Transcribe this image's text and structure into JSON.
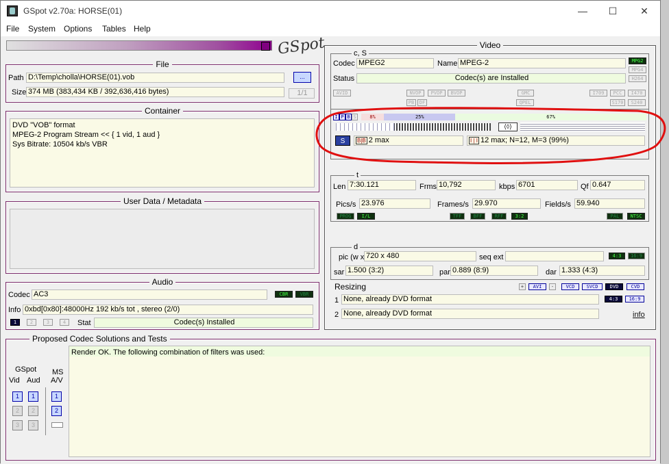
{
  "window": {
    "title": "GSpot v2.70a: HORSE(01)",
    "minimize": "—",
    "maximize": "☐",
    "close": "✕"
  },
  "menu": [
    "File",
    "System",
    "Options",
    "Tables",
    "Help"
  ],
  "logo": "GSpot",
  "file": {
    "title": "File",
    "path_label": "Path",
    "path_value": "D:\\Temp\\cholla\\HORSE(01).vob",
    "browse_label": "...",
    "size_label": "Size",
    "size_value": "374 MB (383,434 KB / 392,636,416 bytes)",
    "page_label": "1/1"
  },
  "container": {
    "title": "Container",
    "lines": [
      "DVD \"VOB\" format",
      "MPEG-2 Program Stream << { 1 vid, 1 aud }",
      "Sys Bitrate: 10504 kb/s VBR"
    ]
  },
  "userdata": {
    "title": "User Data / Metadata"
  },
  "audio": {
    "title": "Audio",
    "codec_label": "Codec",
    "codec_value": "AC3",
    "cbr": "CBR",
    "vbr": "VBR",
    "info_label": "Info",
    "info_value": "0xbd[0x80]:48000Hz  192 kb/s tot , stereo (2/0)",
    "tracks": [
      "1",
      "2",
      "3",
      "4"
    ],
    "stat_label": "Stat",
    "stat_value": "Codec(s) Installed"
  },
  "video": {
    "title": "Video",
    "cs_title": "c, S",
    "codec_label": "Codec",
    "codec_value": "MPEG2",
    "name_label": "Name",
    "name_value": "MPEG-2",
    "codec_chips": [
      "MPG2",
      "MPG4",
      "H264"
    ],
    "status_label": "Status",
    "status_value": "Codec(s) are Installed",
    "chips_row1": [
      "AVID",
      "NVOP",
      "PVOP",
      "BVOP",
      "GMC",
      "I709",
      "PCC",
      "I470"
    ],
    "chips_row2": [
      "PB",
      "DF",
      "QPEL",
      "S170",
      "S240"
    ],
    "gop": {
      "frame_types": [
        "I",
        "P",
        "B",
        "S"
      ],
      "pct_i": "8%",
      "pct_p": "25%",
      "pct_b": "67%",
      "pct_i_value": 8,
      "pct_p_value": 25,
      "pct_b_value": 67,
      "bframes_label": "2 max",
      "gop_label": "12 max; N=12, M=3 (99%)"
    },
    "t_title": "t",
    "len_label": "Len",
    "len_value": "7:30.121",
    "frms_label": "Frms",
    "frms_value": "10,792",
    "kbps_label": "kbps",
    "kbps_value": "6701",
    "qf_label": "Qf",
    "qf_value": "0.647",
    "pics_label": "Pics/s",
    "pics_value": "23.976",
    "frames_label": "Frames/s",
    "frames_value": "29.970",
    "fields_label": "Fields/s",
    "fields_value": "59.940",
    "t_chips": [
      "PROG",
      "I/L",
      "TFF",
      "BFF",
      "RFF",
      "3:2",
      "PAL",
      "NTSC"
    ],
    "d_title": "d",
    "pic_label": "pic (w x h)",
    "pic_value": "720 x 480",
    "seqext_label": "seq ext",
    "ar_chips": [
      "4:3",
      "16:9"
    ],
    "sar_label": "sar",
    "sar_value": "1.500 (3:2)",
    "par_label": "par",
    "par_value": "0.889 (8:9)",
    "dar_label": "dar",
    "dar_value": "1.333 (4:3)",
    "resizing_label": "Resizing",
    "resize_btns": [
      "+",
      "AVI",
      "-",
      "VCD",
      "SVCD",
      "DVD",
      "CVD"
    ],
    "resize_ar": [
      "4:3",
      "16:9"
    ],
    "resize1_num": "1",
    "resize1_value": "None, already DVD format",
    "resize2_num": "2",
    "resize2_value": "None, already DVD format",
    "info_link": "info"
  },
  "proposed": {
    "title": "Proposed Codec Solutions and Tests",
    "gspot_label": "GSpot",
    "vid_label": "Vid",
    "aud_label": "Aud",
    "ms_label": "MS",
    "av_label": "A/V",
    "buttons": [
      "1",
      "2",
      "3"
    ],
    "render_text": "Render OK.  The following combination of filters was used:"
  },
  "annotation": {
    "color": "#e01010"
  }
}
